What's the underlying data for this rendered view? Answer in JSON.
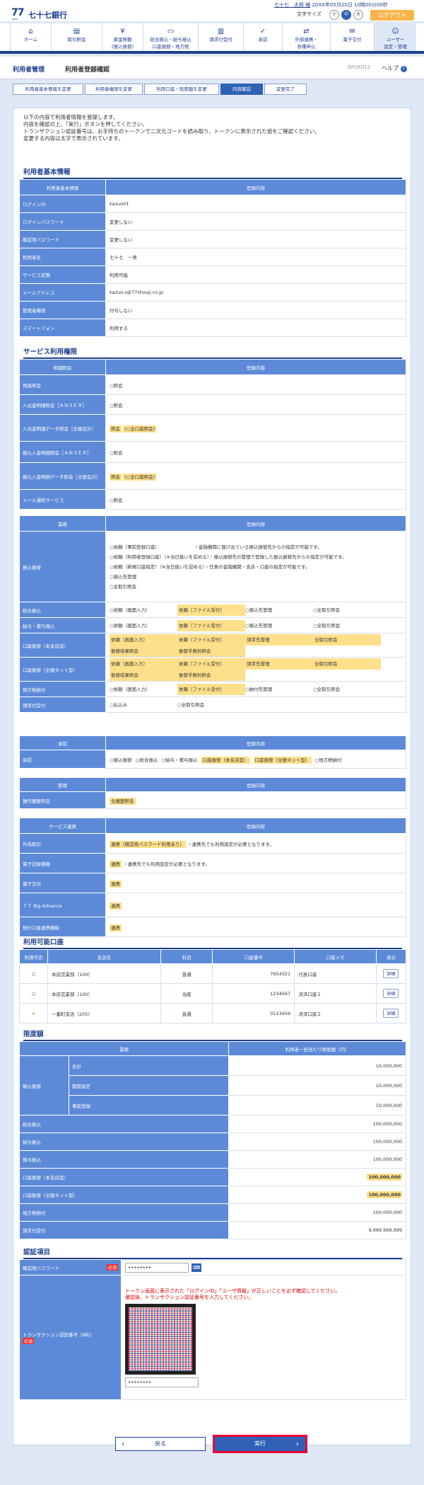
{
  "header": {
    "logo": "77",
    "logo_sub": "BANK",
    "bank_name": "七十七銀行",
    "user_name": "七十七　太郎 様",
    "login_time": "20XX年05月20日 10時00分00秒",
    "font_size_label": "文字サイズ",
    "font_small": "小",
    "font_mid": "中",
    "font_large": "大",
    "logout": "ログアウト"
  },
  "gnav": [
    {
      "icon": "home-icon",
      "label1": "ホーム",
      "label2": ""
    },
    {
      "icon": "document-icon",
      "label1": "取引照会",
      "label2": ""
    },
    {
      "icon": "yen-icon",
      "label1": "資金移動",
      "label2": "(振込振替)"
    },
    {
      "icon": "card-icon",
      "label1": "総合振込・給与振込",
      "label2": "口座振替・地方税"
    },
    {
      "icon": "bill-icon",
      "label1": "請求付受付",
      "label2": ""
    },
    {
      "icon": "check-icon",
      "label1": "承認",
      "label2": ""
    },
    {
      "icon": "link-icon",
      "label1": "外部連携・",
      "label2": "各種申込"
    },
    {
      "icon": "mail-icon",
      "label1": "電子交付",
      "label2": ""
    },
    {
      "icon": "user-icon",
      "label1": "ユーザー",
      "label2": "設定・管理"
    }
  ],
  "title": {
    "main": "利用者管理",
    "sub": "利用者登録確認",
    "code": "BRSK012",
    "help": "ヘルプ"
  },
  "steps": [
    "利用者基本情報を変更",
    "利用者権限を変更",
    "利用口座・限度額を変更",
    "内容確認",
    "変更完了"
  ],
  "intro": [
    "以下の内容で利用者情報を登録します。",
    "内容を確認の上、「実行」ボタンを押してください。",
    "トランザクション認証番号は、お手持ちのトークンで二次元コードを読み取り、トークンに表示された値をご確認ください。",
    "変更する内容は太字で表示されています。"
  ],
  "basic": {
    "title": "利用者基本情報",
    "head": [
      "利用者基本情報",
      "登録内容"
    ],
    "rows": [
      [
        "ログインID",
        "kazuo01"
      ],
      [
        "ログインパスワード",
        "変更しない"
      ],
      [
        "確認用パスワード",
        "変更しない"
      ],
      [
        "利用者名",
        "七十七　一男"
      ],
      [
        "サービス状態",
        "利用可能"
      ],
      [
        "メールアドレス",
        "kazuo.s@77shouji.co.jp"
      ],
      [
        "管理者権限",
        "付与しない"
      ],
      [
        "スマートフォン",
        "利用する"
      ]
    ]
  },
  "service": {
    "title": "サービス利用権限",
    "inquiry_head": [
      "明細照会",
      "登録内容"
    ],
    "inquiry": [
      [
        "残高照会",
        "○照会",
        ""
      ],
      [
        "入出金明細照会［ＡＮＳＥＲ］",
        "○照会",
        ""
      ],
      [
        "入出金明細データ照会［全銀会計］",
        "照会",
        "(○全口座照会)"
      ],
      [
        "振込入金明細照会［ＡＮＳＥＲ］",
        "○照会",
        ""
      ],
      [
        "振込入金明細データ照会［全銀会計］",
        "照会",
        "(○全口座照会)"
      ],
      [
        "メール通知サービス",
        "○照会",
        ""
      ]
    ],
    "biz_head": [
      "業務",
      "登録内容"
    ],
    "furikomi_label": "振込振替",
    "furikomi_lines": [
      "○依頼（事前登録口座）　　　　　　　　・金融機関に届け出ている振込振替先からの指定が可能です。",
      "○依頼（利用者登録口座）（※当日扱いを認める）・振込振替先の管理で登録した振込振替先からの指定が可能です。",
      "○依頼（新規口座指定）（※当日扱いを認める）・任意の金融機関・支店・口座の指定が可能です。",
      "○振込先管理",
      "○全取引照会"
    ],
    "biz": [
      {
        "name": "総合振込",
        "items": [
          "○依頼（画面入力）",
          "依頼（ファイル受付）",
          "○振込先管理",
          "○全取引照会"
        ]
      },
      {
        "name": "給与・賞与振込",
        "items": [
          "○依頼（画面入力）",
          "依頼（ファイル受付）",
          "○振込先管理",
          "○全取引照会"
        ]
      },
      {
        "name": "口座振替（本支店型）",
        "items": [
          "依頼（画面入力）",
          "依頼（ファイル受付）",
          "請求先管理",
          "全取引照会",
          "振替結果照会",
          "振替手数料照会"
        ]
      },
      {
        "name": "口座振替（全銀ネット型）",
        "items": [
          "依頼（画面入力）",
          "依頼（ファイル受付）",
          "請求先管理",
          "全取引照会",
          "振替結果照会",
          "振替手数料照会"
        ]
      },
      {
        "name": "地方税納付",
        "items": [
          "○依頼（画面入力）",
          "依頼（ファイル受付）",
          "○納付先管理",
          "○全取引照会"
        ]
      },
      {
        "name": "請求付受付",
        "items": [
          "○払込み",
          "○全取引照会"
        ]
      }
    ],
    "approve_head": [
      "承認",
      "登録内容"
    ],
    "approve": {
      "name": "承認",
      "items": [
        "○振込振替",
        "○総合振込",
        "○給与・賞与振込",
        "口座振替（本支店型）",
        "口座振替（全銀ネット型）",
        "○地方税納付"
      ]
    },
    "manage_head": [
      "管理",
      "登録内容"
    ],
    "manage": {
      "name": "操作履歴照会",
      "value": "全履歴照会"
    },
    "link_head": [
      "サービス連携",
      "登録内容"
    ],
    "link": [
      [
        "外為取引",
        "連携（確認用パスワード利用あり）",
        "・連携先でも利用設定が必要となります。"
      ],
      [
        "電子記録債権",
        "連携",
        "・連携先でも利用設定が必要となります。"
      ],
      [
        "電子交付",
        "連携",
        ""
      ],
      [
        "７７ Big Advance",
        "連携",
        ""
      ],
      [
        "他行口座連携機能",
        "連携",
        ""
      ]
    ]
  },
  "accounts": {
    "title": "利用可能口座",
    "head": [
      "利用可否",
      "支店名",
      "科目",
      "口座番号",
      "口座メモ",
      "表示"
    ],
    "rows": [
      [
        "○",
        "本店営業部（100）",
        "普通",
        "7654321",
        "代表口座",
        "詳細"
      ],
      [
        "○",
        "本店営業部（100）",
        "当座",
        "1234567",
        "決済口座１",
        "詳細"
      ],
      [
        "×",
        "一番町支店（205）",
        "普通",
        "0123456",
        "決済口座２",
        "詳細"
      ]
    ]
  },
  "limits": {
    "title": "限度額",
    "head": [
      "業務",
      "利用者一回当たり限度額（円）"
    ],
    "furikomi": {
      "name": "振込振替",
      "rows": [
        [
          "合計",
          "10,000,000"
        ],
        [
          "都度指定",
          "10,000,000"
        ],
        [
          "事前登録",
          "10,000,000"
        ]
      ]
    },
    "rows": [
      [
        "総合振込",
        "100,000,000",
        false
      ],
      [
        "給与振込",
        "100,000,000",
        false
      ],
      [
        "賞与振込",
        "100,000,000",
        false
      ],
      [
        "口座振替（本支店型）",
        "100,000,000",
        true
      ],
      [
        "口座振替（全銀ネット型）",
        "100,000,000",
        true
      ],
      [
        "地方税納付",
        "100,000,000",
        false
      ],
      [
        "請求付受付",
        "9,999,999,999",
        false
      ]
    ]
  },
  "auth": {
    "title": "認証項目",
    "confirm_label": "確認用パスワード",
    "required": "必須",
    "password_mask": "••••••••",
    "notice1": "トークン画面に表示された「ログインID」「ユーザ情報」が正しいことを必ず確認してください。",
    "notice2": "確認後、トランザクション認証番号を入力してください。",
    "txn_label": "トランザクション認証番号（8桁）",
    "txn_mask": "••••••••"
  },
  "buttons": {
    "back": "戻る",
    "exec": "実行"
  }
}
